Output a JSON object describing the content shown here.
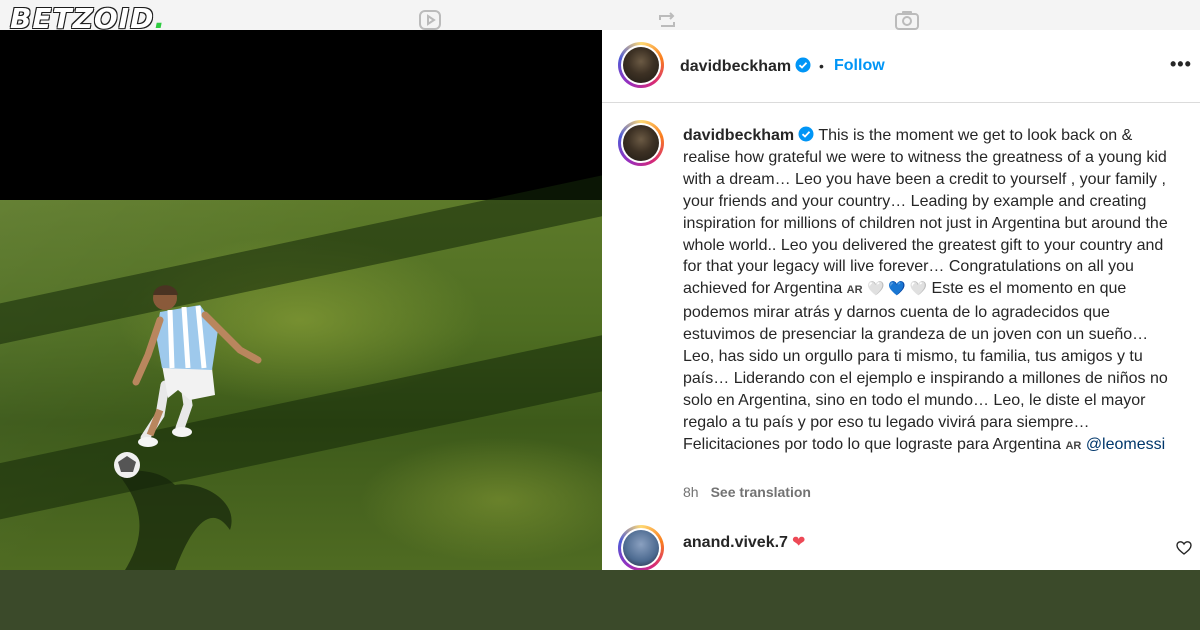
{
  "brand": {
    "name": "BETZOID",
    "dot": "."
  },
  "top_icons": [
    "reels-icon",
    "repost-icon",
    "camera-icon"
  ],
  "post": {
    "header": {
      "username": "davidbeckham",
      "separator": "•",
      "follow_label": "Follow",
      "more_label": "•••"
    },
    "caption": {
      "username": "davidbeckham",
      "english_text": "This is the moment we get to look back on & realise how grateful we were to witness the greatness of a young kid with a dream… Leo you have been a credit to yourself , your family , your friends and your country… Leading by example and creating inspiration for millions of children not just in Argentina but around the whole world.. Leo you delivered the greatest gift to your country and for that your legacy will live forever… Congratulations on all you achieved for Argentina",
      "flag_1": "AR",
      "emoji_hearts": "🤍 💙 🤍",
      "spanish_text": "Este es el momento en que podemos mirar atrás y darnos cuenta de lo agradecidos que estuvimos de presenciar la grandeza de un joven con un sueño… Leo, has sido un orgullo para ti mismo, tu familia, tus amigos y tu país… Liderando con el ejemplo e inspirando a millones de niños no solo en Argentina, sino en todo el mundo… Leo, le diste el mayor regalo a tu país y por eso tu legado vivirá para siempre… Felicitaciones por todo lo que lograste para Argentina",
      "flag_2": "AR",
      "mention": "@leomessi"
    },
    "meta": {
      "time": "8h",
      "see_translation": "See translation"
    },
    "comment": {
      "username": "anand.vivek.7",
      "emoji": "❤"
    }
  },
  "colors": {
    "follow_blue": "#0095f6",
    "verified_blue": "#0095f6",
    "mention": "#00376b",
    "heart_red": "#ed4956"
  }
}
